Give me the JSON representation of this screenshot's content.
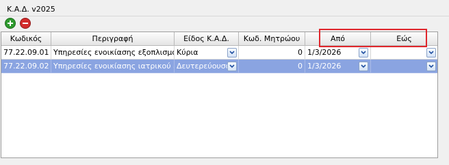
{
  "panel": {
    "title": "Κ.Α.Δ. v2025"
  },
  "toolbar": {
    "add_icon": "plus-circle-icon",
    "remove_icon": "minus-circle-icon",
    "add_color": "#2e9a2e",
    "remove_color": "#d22b2b"
  },
  "grid": {
    "columns": [
      "Κωδικός",
      "Περιγραφή",
      "Είδος Κ.Α.Δ.",
      "Κωδ. Μητρώου",
      "Από",
      "Εώς"
    ],
    "rows": [
      {
        "code": "77.22.09.01",
        "description": "Υπηρεσίες ενοικίασης εξοπλισμού ...",
        "type": "Κύρια",
        "registry_code": "0",
        "from": "1/3/2026",
        "to": ""
      },
      {
        "code": "77.22.09.02",
        "description": "Υπηρεσίες ενοικίασης ιατρικού εξο...",
        "type": "Δευτερεύουσα",
        "registry_code": "0",
        "from": "1/3/2026",
        "to": ""
      }
    ],
    "selected_row_color": "#8aa4e1"
  },
  "annotation": {
    "highlight_color": "#e0262c"
  }
}
